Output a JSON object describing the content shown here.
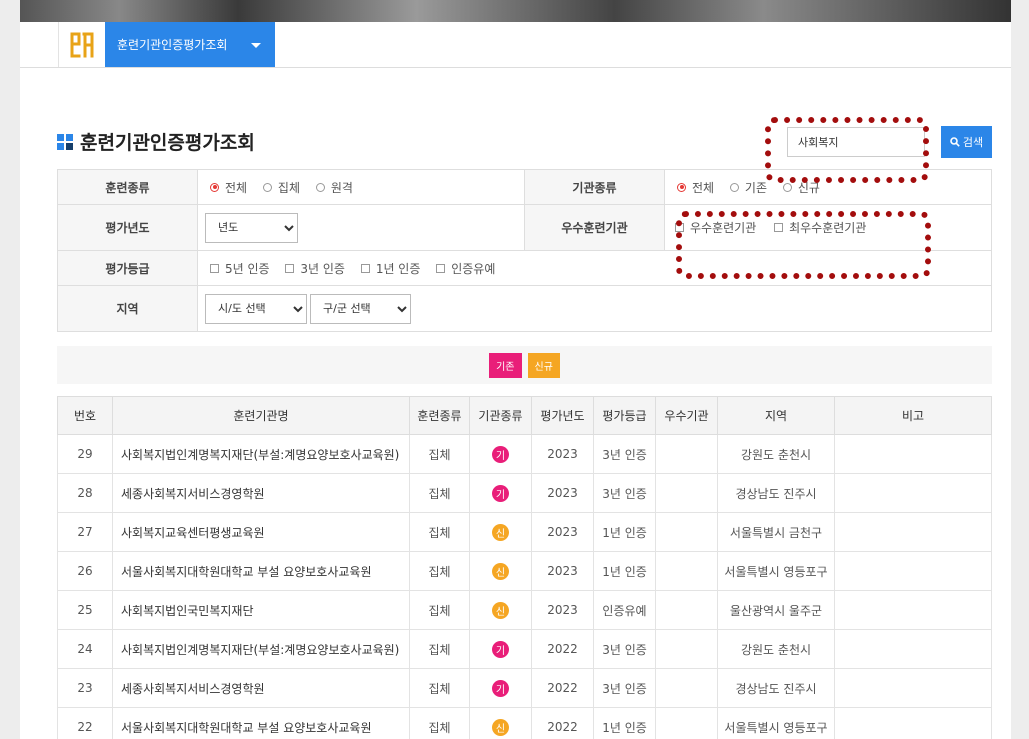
{
  "nav": {
    "menu_label": "훈련기관인증평가조회"
  },
  "page_title": "훈련기관인증평가조회",
  "search": {
    "value": "사회복지",
    "button_label": "검색"
  },
  "filters": {
    "training_type": {
      "label": "훈련종류",
      "options": [
        "전체",
        "집체",
        "원격"
      ],
      "selected": "전체"
    },
    "org_type": {
      "label": "기관종류",
      "options": [
        "전체",
        "기존",
        "신규"
      ],
      "selected": "전체"
    },
    "eval_year": {
      "label": "평가년도",
      "selected": "년도"
    },
    "excellent": {
      "label": "우수훈련기관",
      "options": [
        "우수훈련기관",
        "최우수훈련기관"
      ]
    },
    "grade": {
      "label": "평가등급",
      "options": [
        "5년 인증",
        "3년 인증",
        "1년 인증",
        "인증유예"
      ]
    },
    "region": {
      "label": "지역",
      "sido": "시/도 선택",
      "gugun": "구/군 선택"
    }
  },
  "legend": {
    "existing": "기존",
    "new": "신규"
  },
  "colors": {
    "accent": "#2b86e8",
    "existing": "#e91e79",
    "new": "#f5a623",
    "highlight": "#a30d0d"
  },
  "table": {
    "headers": [
      "번호",
      "훈련기관명",
      "훈련종류",
      "기관종류",
      "평가년도",
      "평가등급",
      "우수기관",
      "지역",
      "비고"
    ],
    "rows": [
      {
        "no": "29",
        "name": "사회복지법인계명복지재단(부설:계명요양보호사교육원)",
        "type": "집체",
        "org": "기",
        "year": "2023",
        "grade": "3년 인증",
        "excellent": "",
        "region": "강원도 춘천시",
        "note": ""
      },
      {
        "no": "28",
        "name": "세종사회복지서비스경영학원",
        "type": "집체",
        "org": "기",
        "year": "2023",
        "grade": "3년 인증",
        "excellent": "",
        "region": "경상남도 진주시",
        "note": ""
      },
      {
        "no": "27",
        "name": "사회복지교육센터평생교육원",
        "type": "집체",
        "org": "신",
        "year": "2023",
        "grade": "1년 인증",
        "excellent": "",
        "region": "서울특별시 금천구",
        "note": ""
      },
      {
        "no": "26",
        "name": "서울사회복지대학원대학교 부설 요양보호사교육원",
        "type": "집체",
        "org": "신",
        "year": "2023",
        "grade": "1년 인증",
        "excellent": "",
        "region": "서울특별시 영등포구",
        "note": ""
      },
      {
        "no": "25",
        "name": "사회복지법인국민복지재단",
        "type": "집체",
        "org": "신",
        "year": "2023",
        "grade": "인증유예",
        "excellent": "",
        "region": "울산광역시 울주군",
        "note": ""
      },
      {
        "no": "24",
        "name": "사회복지법인계명복지재단(부설:계명요양보호사교육원)",
        "type": "집체",
        "org": "기",
        "year": "2022",
        "grade": "3년 인증",
        "excellent": "",
        "region": "강원도 춘천시",
        "note": ""
      },
      {
        "no": "23",
        "name": "세종사회복지서비스경영학원",
        "type": "집체",
        "org": "기",
        "year": "2022",
        "grade": "3년 인증",
        "excellent": "",
        "region": "경상남도 진주시",
        "note": ""
      },
      {
        "no": "22",
        "name": "서울사회복지대학원대학교 부설 요양보호사교육원",
        "type": "집체",
        "org": "신",
        "year": "2022",
        "grade": "1년 인증",
        "excellent": "",
        "region": "서울특별시 영등포구",
        "note": ""
      }
    ]
  }
}
